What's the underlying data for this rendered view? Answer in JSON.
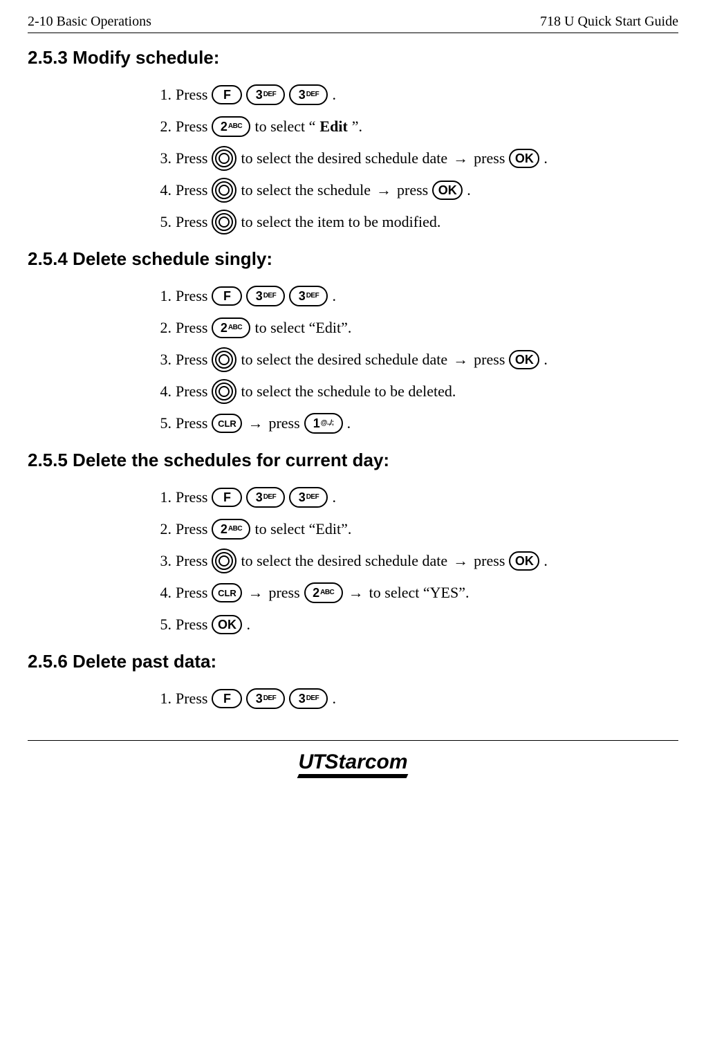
{
  "header": {
    "left": "2-10   Basic Operations",
    "right": "718 U Quick Start Guide"
  },
  "sections": {
    "s253": {
      "title": "2.5.3 Modify schedule:"
    },
    "s254": {
      "title": "2.5.4 Delete schedule singly:"
    },
    "s255": {
      "title": "2.5.5 Delete the schedules for current day:"
    },
    "s256": {
      "title": "2.5.6 Delete past data:"
    }
  },
  "keys": {
    "f": {
      "big": "F",
      "sub": ""
    },
    "k1": {
      "big": "1",
      "sub": "@.,/;"
    },
    "k2": {
      "big": "2",
      "sub": "ABC"
    },
    "k3": {
      "big": "3",
      "sub": "DEF"
    },
    "ok": {
      "big": "OK",
      "sub": ""
    },
    "clr": {
      "big": "CLR",
      "sub": ""
    }
  },
  "text": {
    "press": "Press",
    "arrow": "→",
    "press_lc": "press",
    "period": ".",
    "to_select_edit_pre": " to select “",
    "edit_bold": "Edit",
    "to_select_edit_post": "”.",
    "to_select_edit_plain": " to select “Edit”.",
    "to_select_date": " to select the desired schedule date ",
    "to_select_schedule": " to select the schedule ",
    "to_select_item_mod": " to select the item to be modified.",
    "to_select_sched_del": " to select the schedule to be deleted.",
    "to_select_yes": " to select “YES”."
  },
  "nums": {
    "n1": "1.",
    "n2": "2.",
    "n3": "3.",
    "n4": "4.",
    "n5": "5."
  },
  "logo": {
    "ut": "UT",
    "rest": "Starcom"
  }
}
